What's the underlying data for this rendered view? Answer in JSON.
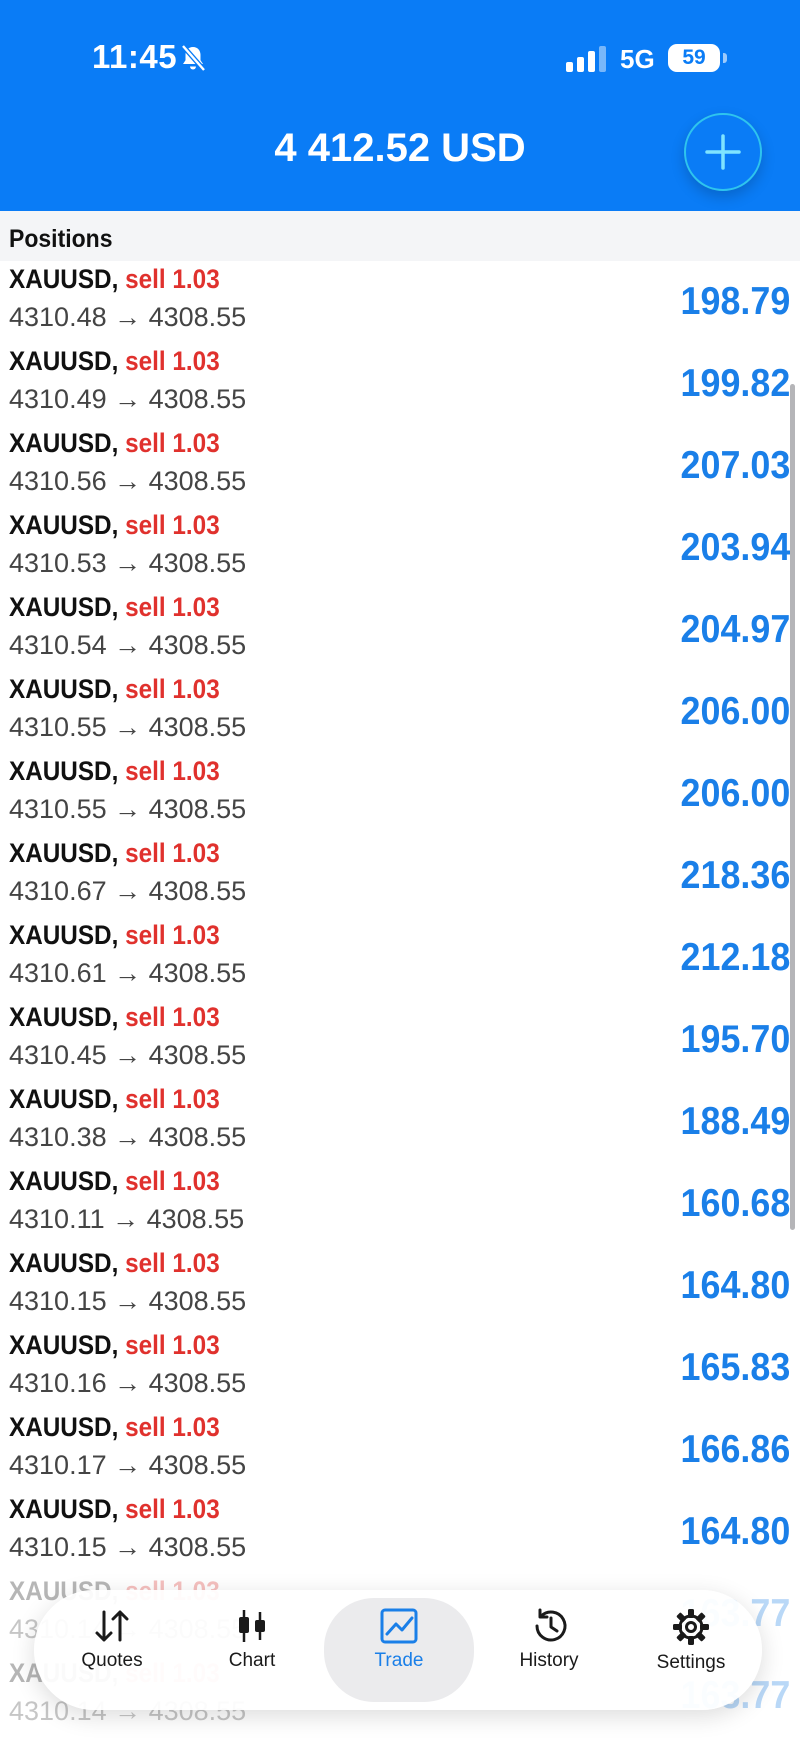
{
  "status_bar": {
    "time": "11:45",
    "network": "5G",
    "battery": "59"
  },
  "header": {
    "balance": "4 412.52 USD"
  },
  "section": {
    "title": "Positions"
  },
  "colors": {
    "header_blue": "#0a7cf6",
    "profit_blue": "#1a7fe8",
    "sell_red": "#e0312d"
  },
  "positions": [
    {
      "symbol": "XAUUSD,",
      "side": "sell 1.03",
      "prices": "4310.48 → 4308.55",
      "profit": "198.79"
    },
    {
      "symbol": "XAUUSD,",
      "side": "sell 1.03",
      "prices": "4310.49 → 4308.55",
      "profit": "199.82"
    },
    {
      "symbol": "XAUUSD,",
      "side": "sell 1.03",
      "prices": "4310.56 → 4308.55",
      "profit": "207.03"
    },
    {
      "symbol": "XAUUSD,",
      "side": "sell 1.03",
      "prices": "4310.53 → 4308.55",
      "profit": "203.94"
    },
    {
      "symbol": "XAUUSD,",
      "side": "sell 1.03",
      "prices": "4310.54 → 4308.55",
      "profit": "204.97"
    },
    {
      "symbol": "XAUUSD,",
      "side": "sell 1.03",
      "prices": "4310.55 → 4308.55",
      "profit": "206.00"
    },
    {
      "symbol": "XAUUSD,",
      "side": "sell 1.03",
      "prices": "4310.55 → 4308.55",
      "profit": "206.00"
    },
    {
      "symbol": "XAUUSD,",
      "side": "sell 1.03",
      "prices": "4310.67 → 4308.55",
      "profit": "218.36"
    },
    {
      "symbol": "XAUUSD,",
      "side": "sell 1.03",
      "prices": "4310.61 → 4308.55",
      "profit": "212.18"
    },
    {
      "symbol": "XAUUSD,",
      "side": "sell 1.03",
      "prices": "4310.45 → 4308.55",
      "profit": "195.70"
    },
    {
      "symbol": "XAUUSD,",
      "side": "sell 1.03",
      "prices": "4310.38 → 4308.55",
      "profit": "188.49"
    },
    {
      "symbol": "XAUUSD,",
      "side": "sell 1.03",
      "prices": "4310.11 → 4308.55",
      "profit": "160.68"
    },
    {
      "symbol": "XAUUSD,",
      "side": "sell 1.03",
      "prices": "4310.15 → 4308.55",
      "profit": "164.80"
    },
    {
      "symbol": "XAUUSD,",
      "side": "sell 1.03",
      "prices": "4310.16 → 4308.55",
      "profit": "165.83"
    },
    {
      "symbol": "XAUUSD,",
      "side": "sell 1.03",
      "prices": "4310.17 → 4308.55",
      "profit": "166.86"
    },
    {
      "symbol": "XAUUSD,",
      "side": "sell 1.03",
      "prices": "4310.15 → 4308.55",
      "profit": "164.80"
    }
  ],
  "partial_rows": [
    {
      "symbol": "XAUUSD,",
      "side": "sell 1.03",
      "prices": "4310.14 → 4308.55",
      "profit": "163.77"
    },
    {
      "symbol": "XAUUSD,",
      "side": "sell 1.03",
      "prices": "4310.14 → 4308.55",
      "profit": "163.77"
    }
  ],
  "tabbar": {
    "quotes": "Quotes",
    "chart": "Chart",
    "trade": "Trade",
    "history": "History",
    "settings": "Settings"
  }
}
